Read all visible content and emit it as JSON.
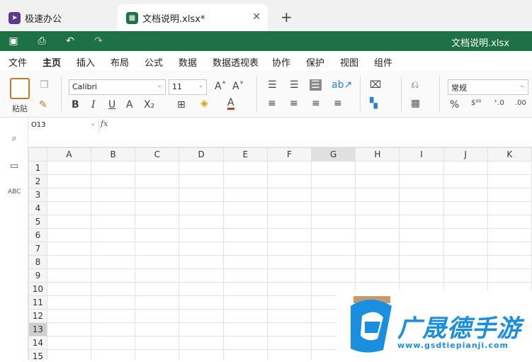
{
  "tabs": [
    {
      "label": "极速办公"
    },
    {
      "label": "文档说明.xlsx*"
    }
  ],
  "quick": {
    "doc_title": "文档说明.xlsx"
  },
  "menu": [
    "文件",
    "主页",
    "插入",
    "布局",
    "公式",
    "数据",
    "数据透视表",
    "协作",
    "保护",
    "视图",
    "组件"
  ],
  "ribbon": {
    "paste": "粘贴",
    "font": "Calibri",
    "size": "11",
    "number_format": "常规",
    "bold": "B",
    "italic": "I",
    "underline": "U",
    "font_color": "A"
  },
  "formula": {
    "cell": "O13",
    "fx": "fx"
  },
  "columns": [
    "A",
    "B",
    "C",
    "D",
    "E",
    "F",
    "G",
    "H",
    "I",
    "J",
    "K"
  ],
  "rows": [
    "1",
    "2",
    "3",
    "4",
    "5",
    "6",
    "7",
    "8",
    "9",
    "10",
    "11",
    "12",
    "13",
    "14",
    "15"
  ],
  "watermark": {
    "name": "广晟德手游",
    "url": "www.gsdtiepianji.com"
  },
  "colors": {
    "brand": "#1e7145",
    "accent": "#2a7fd8",
    "watermark": "#1a8fe0"
  }
}
